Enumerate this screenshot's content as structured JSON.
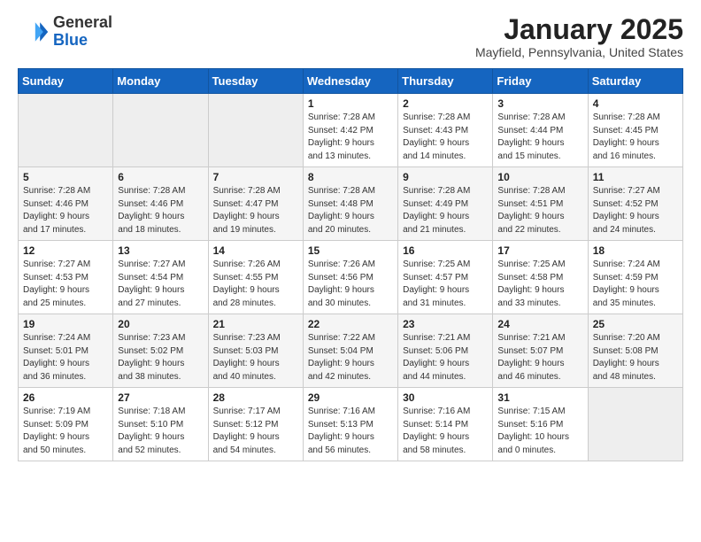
{
  "header": {
    "logo_general": "General",
    "logo_blue": "Blue",
    "month_title": "January 2025",
    "location": "Mayfield, Pennsylvania, United States"
  },
  "weekdays": [
    "Sunday",
    "Monday",
    "Tuesday",
    "Wednesday",
    "Thursday",
    "Friday",
    "Saturday"
  ],
  "weeks": [
    [
      {
        "day": "",
        "sunrise": "",
        "sunset": "",
        "daylight": ""
      },
      {
        "day": "",
        "sunrise": "",
        "sunset": "",
        "daylight": ""
      },
      {
        "day": "",
        "sunrise": "",
        "sunset": "",
        "daylight": ""
      },
      {
        "day": "1",
        "sunrise": "Sunrise: 7:28 AM",
        "sunset": "Sunset: 4:42 PM",
        "daylight": "Daylight: 9 hours and 13 minutes."
      },
      {
        "day": "2",
        "sunrise": "Sunrise: 7:28 AM",
        "sunset": "Sunset: 4:43 PM",
        "daylight": "Daylight: 9 hours and 14 minutes."
      },
      {
        "day": "3",
        "sunrise": "Sunrise: 7:28 AM",
        "sunset": "Sunset: 4:44 PM",
        "daylight": "Daylight: 9 hours and 15 minutes."
      },
      {
        "day": "4",
        "sunrise": "Sunrise: 7:28 AM",
        "sunset": "Sunset: 4:45 PM",
        "daylight": "Daylight: 9 hours and 16 minutes."
      }
    ],
    [
      {
        "day": "5",
        "sunrise": "Sunrise: 7:28 AM",
        "sunset": "Sunset: 4:46 PM",
        "daylight": "Daylight: 9 hours and 17 minutes."
      },
      {
        "day": "6",
        "sunrise": "Sunrise: 7:28 AM",
        "sunset": "Sunset: 4:46 PM",
        "daylight": "Daylight: 9 hours and 18 minutes."
      },
      {
        "day": "7",
        "sunrise": "Sunrise: 7:28 AM",
        "sunset": "Sunset: 4:47 PM",
        "daylight": "Daylight: 9 hours and 19 minutes."
      },
      {
        "day": "8",
        "sunrise": "Sunrise: 7:28 AM",
        "sunset": "Sunset: 4:48 PM",
        "daylight": "Daylight: 9 hours and 20 minutes."
      },
      {
        "day": "9",
        "sunrise": "Sunrise: 7:28 AM",
        "sunset": "Sunset: 4:49 PM",
        "daylight": "Daylight: 9 hours and 21 minutes."
      },
      {
        "day": "10",
        "sunrise": "Sunrise: 7:28 AM",
        "sunset": "Sunset: 4:51 PM",
        "daylight": "Daylight: 9 hours and 22 minutes."
      },
      {
        "day": "11",
        "sunrise": "Sunrise: 7:27 AM",
        "sunset": "Sunset: 4:52 PM",
        "daylight": "Daylight: 9 hours and 24 minutes."
      }
    ],
    [
      {
        "day": "12",
        "sunrise": "Sunrise: 7:27 AM",
        "sunset": "Sunset: 4:53 PM",
        "daylight": "Daylight: 9 hours and 25 minutes."
      },
      {
        "day": "13",
        "sunrise": "Sunrise: 7:27 AM",
        "sunset": "Sunset: 4:54 PM",
        "daylight": "Daylight: 9 hours and 27 minutes."
      },
      {
        "day": "14",
        "sunrise": "Sunrise: 7:26 AM",
        "sunset": "Sunset: 4:55 PM",
        "daylight": "Daylight: 9 hours and 28 minutes."
      },
      {
        "day": "15",
        "sunrise": "Sunrise: 7:26 AM",
        "sunset": "Sunset: 4:56 PM",
        "daylight": "Daylight: 9 hours and 30 minutes."
      },
      {
        "day": "16",
        "sunrise": "Sunrise: 7:25 AM",
        "sunset": "Sunset: 4:57 PM",
        "daylight": "Daylight: 9 hours and 31 minutes."
      },
      {
        "day": "17",
        "sunrise": "Sunrise: 7:25 AM",
        "sunset": "Sunset: 4:58 PM",
        "daylight": "Daylight: 9 hours and 33 minutes."
      },
      {
        "day": "18",
        "sunrise": "Sunrise: 7:24 AM",
        "sunset": "Sunset: 4:59 PM",
        "daylight": "Daylight: 9 hours and 35 minutes."
      }
    ],
    [
      {
        "day": "19",
        "sunrise": "Sunrise: 7:24 AM",
        "sunset": "Sunset: 5:01 PM",
        "daylight": "Daylight: 9 hours and 36 minutes."
      },
      {
        "day": "20",
        "sunrise": "Sunrise: 7:23 AM",
        "sunset": "Sunset: 5:02 PM",
        "daylight": "Daylight: 9 hours and 38 minutes."
      },
      {
        "day": "21",
        "sunrise": "Sunrise: 7:23 AM",
        "sunset": "Sunset: 5:03 PM",
        "daylight": "Daylight: 9 hours and 40 minutes."
      },
      {
        "day": "22",
        "sunrise": "Sunrise: 7:22 AM",
        "sunset": "Sunset: 5:04 PM",
        "daylight": "Daylight: 9 hours and 42 minutes."
      },
      {
        "day": "23",
        "sunrise": "Sunrise: 7:21 AM",
        "sunset": "Sunset: 5:06 PM",
        "daylight": "Daylight: 9 hours and 44 minutes."
      },
      {
        "day": "24",
        "sunrise": "Sunrise: 7:21 AM",
        "sunset": "Sunset: 5:07 PM",
        "daylight": "Daylight: 9 hours and 46 minutes."
      },
      {
        "day": "25",
        "sunrise": "Sunrise: 7:20 AM",
        "sunset": "Sunset: 5:08 PM",
        "daylight": "Daylight: 9 hours and 48 minutes."
      }
    ],
    [
      {
        "day": "26",
        "sunrise": "Sunrise: 7:19 AM",
        "sunset": "Sunset: 5:09 PM",
        "daylight": "Daylight: 9 hours and 50 minutes."
      },
      {
        "day": "27",
        "sunrise": "Sunrise: 7:18 AM",
        "sunset": "Sunset: 5:10 PM",
        "daylight": "Daylight: 9 hours and 52 minutes."
      },
      {
        "day": "28",
        "sunrise": "Sunrise: 7:17 AM",
        "sunset": "Sunset: 5:12 PM",
        "daylight": "Daylight: 9 hours and 54 minutes."
      },
      {
        "day": "29",
        "sunrise": "Sunrise: 7:16 AM",
        "sunset": "Sunset: 5:13 PM",
        "daylight": "Daylight: 9 hours and 56 minutes."
      },
      {
        "day": "30",
        "sunrise": "Sunrise: 7:16 AM",
        "sunset": "Sunset: 5:14 PM",
        "daylight": "Daylight: 9 hours and 58 minutes."
      },
      {
        "day": "31",
        "sunrise": "Sunrise: 7:15 AM",
        "sunset": "Sunset: 5:16 PM",
        "daylight": "Daylight: 10 hours and 0 minutes."
      },
      {
        "day": "",
        "sunrise": "",
        "sunset": "",
        "daylight": ""
      }
    ]
  ]
}
